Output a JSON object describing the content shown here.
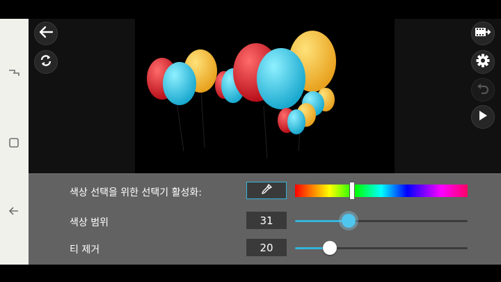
{
  "controls": {
    "back_icon": "arrow-left-icon",
    "rotate_icon": "rotate-icon",
    "export_icon": "film-export-icon",
    "settings_icon": "gear-icon",
    "undo_icon": "undo-icon",
    "play_icon": "play-icon"
  },
  "android_nav": [
    "recent-apps-icon",
    "home-icon",
    "back-icon"
  ],
  "chroma_panel": {
    "picker_label": "색상 선택을 위한 선택기 활성화:",
    "picker_icon": "eyedropper-icon",
    "hue_position": 0.33,
    "range_label": "색상 범위",
    "range_value": "31",
    "range_fraction": 0.31,
    "noise_label": "티 제거",
    "noise_value": "20",
    "noise_fraction": 0.2
  },
  "colors": {
    "accent": "#35b4dc",
    "panel": "#626262"
  }
}
